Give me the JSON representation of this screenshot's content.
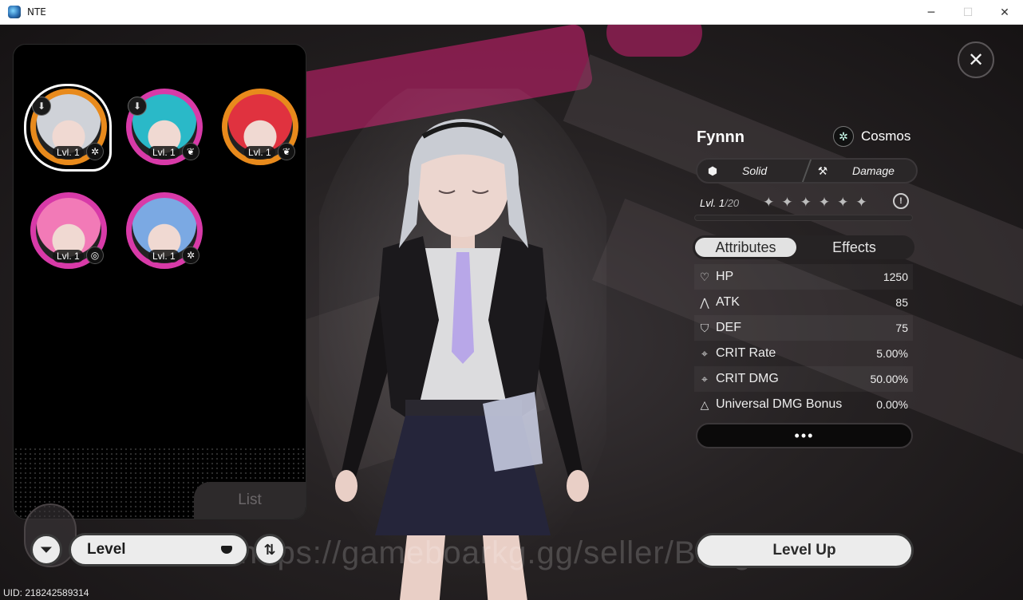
{
  "window": {
    "title": "NTE",
    "minimize": "─",
    "maximize": "☐",
    "close": "✕"
  },
  "viewport": {
    "close": "✕",
    "watermark": "https://gameboarkg.gg/seller/BangJohn",
    "uid": "UID: 218242589314"
  },
  "roster": {
    "tab_label": "List",
    "characters": [
      {
        "level": "Lvl. 1",
        "ring_color": "#e88a1c",
        "element_icon": "cosmos-icon",
        "element_glyph": "✲",
        "hair": "#cfd2d8",
        "has_download": true,
        "selected": true
      },
      {
        "level": "Lvl. 1",
        "ring_color": "#d83aa8",
        "element_icon": "leaf-icon",
        "element_glyph": "❦",
        "hair": "#2ab9c8",
        "has_download": true,
        "selected": false
      },
      {
        "level": "Lvl. 1",
        "ring_color": "#e88a1c",
        "element_icon": "leaf-icon",
        "element_glyph": "❦",
        "hair": "#e0323f",
        "has_download": false,
        "selected": false
      },
      {
        "level": "Lvl. 1",
        "ring_color": "#d83aa8",
        "element_icon": "swirl-icon",
        "element_glyph": "◎",
        "hair": "#f27ab7",
        "has_download": false,
        "selected": false
      },
      {
        "level": "Lvl. 1",
        "ring_color": "#d83aa8",
        "element_icon": "cosmos-icon",
        "element_glyph": "✲",
        "hair": "#7ba9e3",
        "has_download": false,
        "selected": false
      }
    ]
  },
  "controls": {
    "filter_glyph": "⏷",
    "sort_select": "Level",
    "sort_toggle_glyph": "⇅"
  },
  "character": {
    "name": "Fynnn",
    "path_icon": "cosmos-icon",
    "path_glyph": "✲",
    "path": "Cosmos",
    "tags": [
      {
        "icon": "cube-icon",
        "glyph": "⬢",
        "label": "Solid"
      },
      {
        "icon": "hammer-icon",
        "glyph": "⚒",
        "label": "Damage"
      }
    ],
    "level_prefix": "Lvl.",
    "level_current": "1",
    "level_max": "/20",
    "stars_glyph": "✦",
    "star_count": 6,
    "info_glyph": "!",
    "tabs": [
      "Attributes",
      "Effects"
    ],
    "stats": [
      {
        "icon": "heart-icon",
        "glyph": "♡",
        "name": "HP",
        "value": "1250"
      },
      {
        "icon": "atk-icon",
        "glyph": "⋀",
        "name": "ATK",
        "value": "85"
      },
      {
        "icon": "shield-icon",
        "glyph": "⛉",
        "name": "DEF",
        "value": "75"
      },
      {
        "icon": "crosshair-icon",
        "glyph": "⌖",
        "name": "CRIT Rate",
        "value": "5.00%"
      },
      {
        "icon": "crosshair-icon",
        "glyph": "⌖",
        "name": "CRIT DMG",
        "value": "50.00%"
      },
      {
        "icon": "triangle-icon",
        "glyph": "△",
        "name": "Universal DMG Bonus",
        "value": "0.00%"
      }
    ],
    "more_label": "•••",
    "level_up": "Level Up"
  }
}
